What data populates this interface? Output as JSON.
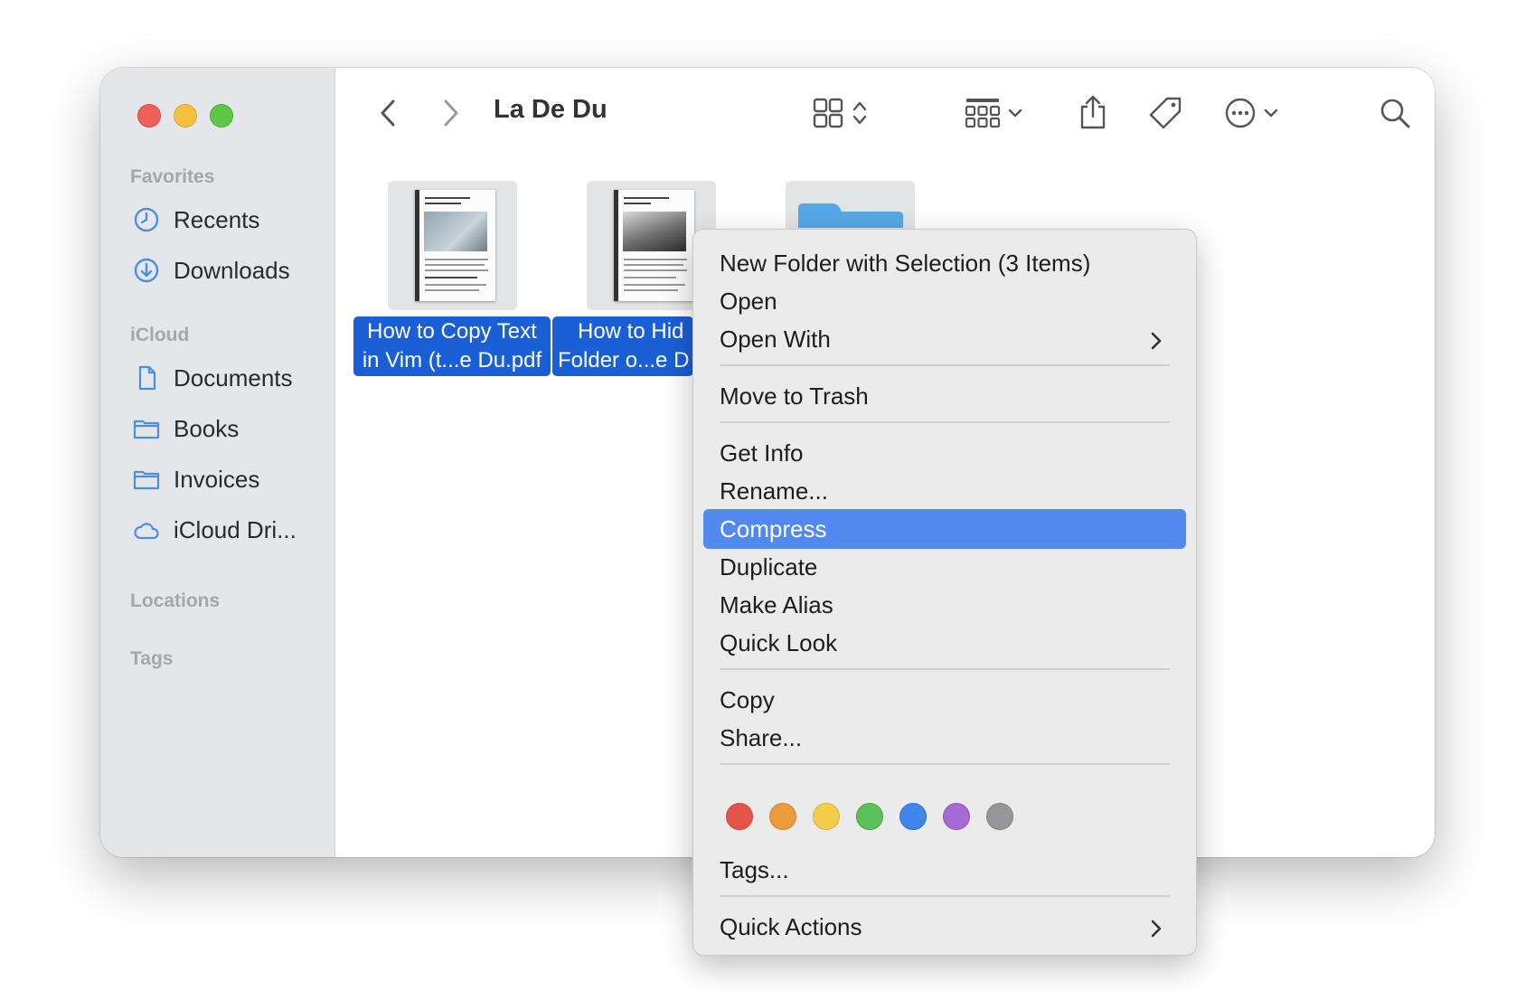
{
  "window": {
    "title": "La De Du"
  },
  "sidebar": {
    "favorites_label": "Favorites",
    "favorites": [
      {
        "label": "Recents",
        "icon": "clock-icon"
      },
      {
        "label": "Downloads",
        "icon": "download-icon"
      }
    ],
    "icloud_label": "iCloud",
    "icloud": [
      {
        "label": "Documents",
        "icon": "document-icon"
      },
      {
        "label": "Books",
        "icon": "folder-icon"
      },
      {
        "label": "Invoices",
        "icon": "folder-icon"
      },
      {
        "label": "iCloud Dri...",
        "icon": "cloud-icon"
      }
    ],
    "locations_label": "Locations",
    "tags_label": "Tags"
  },
  "toolbar": {
    "icons": [
      "back-icon",
      "forward-icon",
      "icon-view-icon",
      "group-icon",
      "share-icon",
      "tag-icon",
      "more-actions-icon",
      "search-icon"
    ]
  },
  "files": [
    {
      "name_line1": "How to Copy Text",
      "name_line2": "in Vim (t...e Du.pdf",
      "doc_title": "How to Copy Text to Clipboard)"
    },
    {
      "name_line1": "How to Hid",
      "name_line2": "Folder o...e D",
      "doc_title": "How to Hide a Fol Mac"
    },
    {
      "name_line1": "",
      "name_line2": ""
    }
  ],
  "context_menu": {
    "items": {
      "new_folder": "New Folder with Selection (3 Items)",
      "open": "Open",
      "open_with": "Open With",
      "move_to_trash": "Move to Trash",
      "get_info": "Get Info",
      "rename": "Rename...",
      "compress": "Compress",
      "duplicate": "Duplicate",
      "make_alias": "Make Alias",
      "quick_look": "Quick Look",
      "copy": "Copy",
      "share": "Share...",
      "tags": "Tags...",
      "quick_actions": "Quick Actions"
    },
    "selected": "Compress",
    "tag_colors": [
      {
        "name": "red",
        "hex": "#e5534b"
      },
      {
        "name": "orange",
        "hex": "#eb9a3c"
      },
      {
        "name": "yellow",
        "hex": "#f2cc4a"
      },
      {
        "name": "green",
        "hex": "#5cc05a"
      },
      {
        "name": "blue",
        "hex": "#3f85ec"
      },
      {
        "name": "purple",
        "hex": "#a66bd3"
      },
      {
        "name": "gray",
        "hex": "#97979b"
      }
    ]
  },
  "colors": {
    "accent": "#5289ee",
    "selection": "#1a5fd6",
    "sidebar_icon": "#4a90e2"
  }
}
